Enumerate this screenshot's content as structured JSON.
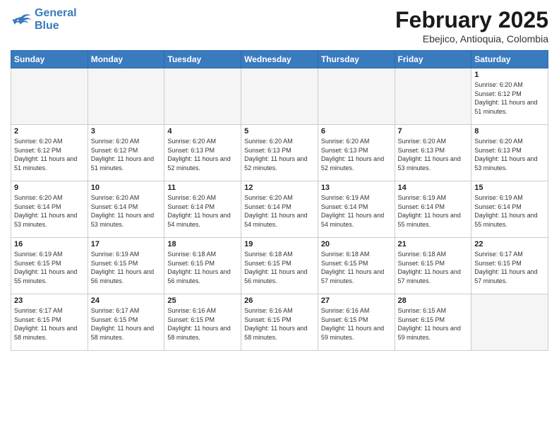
{
  "header": {
    "logo_general": "General",
    "logo_blue": "Blue",
    "month_title": "February 2025",
    "location": "Ebejico, Antioquia, Colombia"
  },
  "days_of_week": [
    "Sunday",
    "Monday",
    "Tuesday",
    "Wednesday",
    "Thursday",
    "Friday",
    "Saturday"
  ],
  "weeks": [
    [
      {
        "day": "",
        "empty": true
      },
      {
        "day": "",
        "empty": true
      },
      {
        "day": "",
        "empty": true
      },
      {
        "day": "",
        "empty": true
      },
      {
        "day": "",
        "empty": true
      },
      {
        "day": "",
        "empty": true
      },
      {
        "day": "1",
        "sunrise": "Sunrise: 6:20 AM",
        "sunset": "Sunset: 6:12 PM",
        "daylight": "Daylight: 11 hours and 51 minutes."
      }
    ],
    [
      {
        "day": "2",
        "sunrise": "Sunrise: 6:20 AM",
        "sunset": "Sunset: 6:12 PM",
        "daylight": "Daylight: 11 hours and 51 minutes."
      },
      {
        "day": "3",
        "sunrise": "Sunrise: 6:20 AM",
        "sunset": "Sunset: 6:12 PM",
        "daylight": "Daylight: 11 hours and 51 minutes."
      },
      {
        "day": "4",
        "sunrise": "Sunrise: 6:20 AM",
        "sunset": "Sunset: 6:13 PM",
        "daylight": "Daylight: 11 hours and 52 minutes."
      },
      {
        "day": "5",
        "sunrise": "Sunrise: 6:20 AM",
        "sunset": "Sunset: 6:13 PM",
        "daylight": "Daylight: 11 hours and 52 minutes."
      },
      {
        "day": "6",
        "sunrise": "Sunrise: 6:20 AM",
        "sunset": "Sunset: 6:13 PM",
        "daylight": "Daylight: 11 hours and 52 minutes."
      },
      {
        "day": "7",
        "sunrise": "Sunrise: 6:20 AM",
        "sunset": "Sunset: 6:13 PM",
        "daylight": "Daylight: 11 hours and 53 minutes."
      },
      {
        "day": "8",
        "sunrise": "Sunrise: 6:20 AM",
        "sunset": "Sunset: 6:13 PM",
        "daylight": "Daylight: 11 hours and 53 minutes."
      }
    ],
    [
      {
        "day": "9",
        "sunrise": "Sunrise: 6:20 AM",
        "sunset": "Sunset: 6:14 PM",
        "daylight": "Daylight: 11 hours and 53 minutes."
      },
      {
        "day": "10",
        "sunrise": "Sunrise: 6:20 AM",
        "sunset": "Sunset: 6:14 PM",
        "daylight": "Daylight: 11 hours and 53 minutes."
      },
      {
        "day": "11",
        "sunrise": "Sunrise: 6:20 AM",
        "sunset": "Sunset: 6:14 PM",
        "daylight": "Daylight: 11 hours and 54 minutes."
      },
      {
        "day": "12",
        "sunrise": "Sunrise: 6:20 AM",
        "sunset": "Sunset: 6:14 PM",
        "daylight": "Daylight: 11 hours and 54 minutes."
      },
      {
        "day": "13",
        "sunrise": "Sunrise: 6:19 AM",
        "sunset": "Sunset: 6:14 PM",
        "daylight": "Daylight: 11 hours and 54 minutes."
      },
      {
        "day": "14",
        "sunrise": "Sunrise: 6:19 AM",
        "sunset": "Sunset: 6:14 PM",
        "daylight": "Daylight: 11 hours and 55 minutes."
      },
      {
        "day": "15",
        "sunrise": "Sunrise: 6:19 AM",
        "sunset": "Sunset: 6:14 PM",
        "daylight": "Daylight: 11 hours and 55 minutes."
      }
    ],
    [
      {
        "day": "16",
        "sunrise": "Sunrise: 6:19 AM",
        "sunset": "Sunset: 6:15 PM",
        "daylight": "Daylight: 11 hours and 55 minutes."
      },
      {
        "day": "17",
        "sunrise": "Sunrise: 6:19 AM",
        "sunset": "Sunset: 6:15 PM",
        "daylight": "Daylight: 11 hours and 56 minutes."
      },
      {
        "day": "18",
        "sunrise": "Sunrise: 6:18 AM",
        "sunset": "Sunset: 6:15 PM",
        "daylight": "Daylight: 11 hours and 56 minutes."
      },
      {
        "day": "19",
        "sunrise": "Sunrise: 6:18 AM",
        "sunset": "Sunset: 6:15 PM",
        "daylight": "Daylight: 11 hours and 56 minutes."
      },
      {
        "day": "20",
        "sunrise": "Sunrise: 6:18 AM",
        "sunset": "Sunset: 6:15 PM",
        "daylight": "Daylight: 11 hours and 57 minutes."
      },
      {
        "day": "21",
        "sunrise": "Sunrise: 6:18 AM",
        "sunset": "Sunset: 6:15 PM",
        "daylight": "Daylight: 11 hours and 57 minutes."
      },
      {
        "day": "22",
        "sunrise": "Sunrise: 6:17 AM",
        "sunset": "Sunset: 6:15 PM",
        "daylight": "Daylight: 11 hours and 57 minutes."
      }
    ],
    [
      {
        "day": "23",
        "sunrise": "Sunrise: 6:17 AM",
        "sunset": "Sunset: 6:15 PM",
        "daylight": "Daylight: 11 hours and 58 minutes."
      },
      {
        "day": "24",
        "sunrise": "Sunrise: 6:17 AM",
        "sunset": "Sunset: 6:15 PM",
        "daylight": "Daylight: 11 hours and 58 minutes."
      },
      {
        "day": "25",
        "sunrise": "Sunrise: 6:16 AM",
        "sunset": "Sunset: 6:15 PM",
        "daylight": "Daylight: 11 hours and 58 minutes."
      },
      {
        "day": "26",
        "sunrise": "Sunrise: 6:16 AM",
        "sunset": "Sunset: 6:15 PM",
        "daylight": "Daylight: 11 hours and 58 minutes."
      },
      {
        "day": "27",
        "sunrise": "Sunrise: 6:16 AM",
        "sunset": "Sunset: 6:15 PM",
        "daylight": "Daylight: 11 hours and 59 minutes."
      },
      {
        "day": "28",
        "sunrise": "Sunrise: 6:15 AM",
        "sunset": "Sunset: 6:15 PM",
        "daylight": "Daylight: 11 hours and 59 minutes."
      },
      {
        "day": "",
        "empty": true
      }
    ]
  ]
}
